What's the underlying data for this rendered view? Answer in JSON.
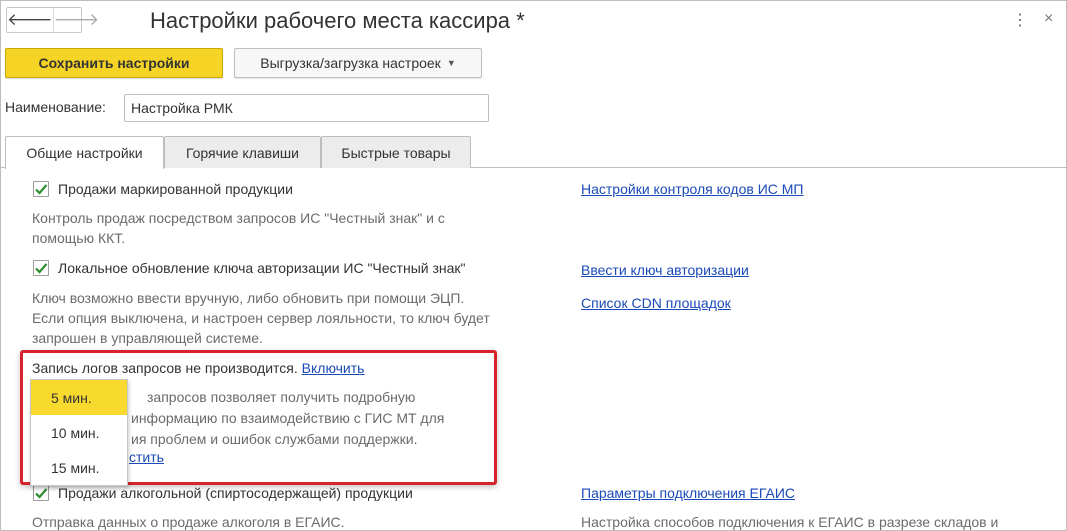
{
  "window": {
    "title": "Настройки рабочего места кассира *",
    "back_glyph": "🡐",
    "forward_glyph": "🡒",
    "more_glyph": "⋮",
    "close_glyph": "×"
  },
  "toolbar": {
    "save_label": "Сохранить настройки",
    "import_export_label": "Выгрузка/загрузка настроек"
  },
  "name_field": {
    "label": "Наименование:",
    "value": "Настройка РМК"
  },
  "tabs": [
    {
      "label": "Общие настройки",
      "active": true
    },
    {
      "label": "Горячие клавиши",
      "active": false
    },
    {
      "label": "Быстрые товары",
      "active": false
    }
  ],
  "settings": {
    "marked_products": {
      "label": "Продажи маркированной продукции",
      "checked": true,
      "desc_lines": [
        "Контроль продаж посредством запросов ИС \"Честный знак\" и с",
        "помощью ККТ."
      ],
      "link": "Настройки контроля кодов ИС МП"
    },
    "local_key_update": {
      "label": "Локальное обновление ключа авторизации ИС \"Честный знак\"",
      "checked": true,
      "desc_lines": [
        "Ключ возможно ввести вручную, либо обновить при помощи ЭЦП.",
        "Если опция выключена, и настроен сервер лояльности, то ключ будет",
        "запрошен в управляющей системе."
      ],
      "link_key": "Ввести ключ авторизации",
      "link_cdn": "Список CDN площадок"
    },
    "request_logs": {
      "status": "Запись логов запросов не производится.",
      "enable_link": "Включить",
      "desc_lines": [
        "запросов позволяет получить подробную",
        "информацию по взаимодействию с ГИС МТ для",
        "ия проблем и ошибок службами поддержки."
      ],
      "clear_link": "стить"
    },
    "alcohol": {
      "label": "Продажи алкогольной (спиртосодержащей) продукции",
      "checked": true,
      "desc": "Отправка данных о продаже алкоголя в ЕГАИС.",
      "link": "Параметры подключения ЕГАИС",
      "desc_right": "Настройка способов подключения к ЕГАИС в разрезе складов и"
    }
  },
  "popup": {
    "items": [
      "5 мин.",
      "10 мин.",
      "15 мин."
    ],
    "selected_index": 0
  },
  "colors": {
    "save_button": "#f5d426",
    "link": "#1a4ab8",
    "highlight_border": "#d6232d",
    "popup_selected": "#f8d92e",
    "checkmark": "#2e8b2e"
  }
}
